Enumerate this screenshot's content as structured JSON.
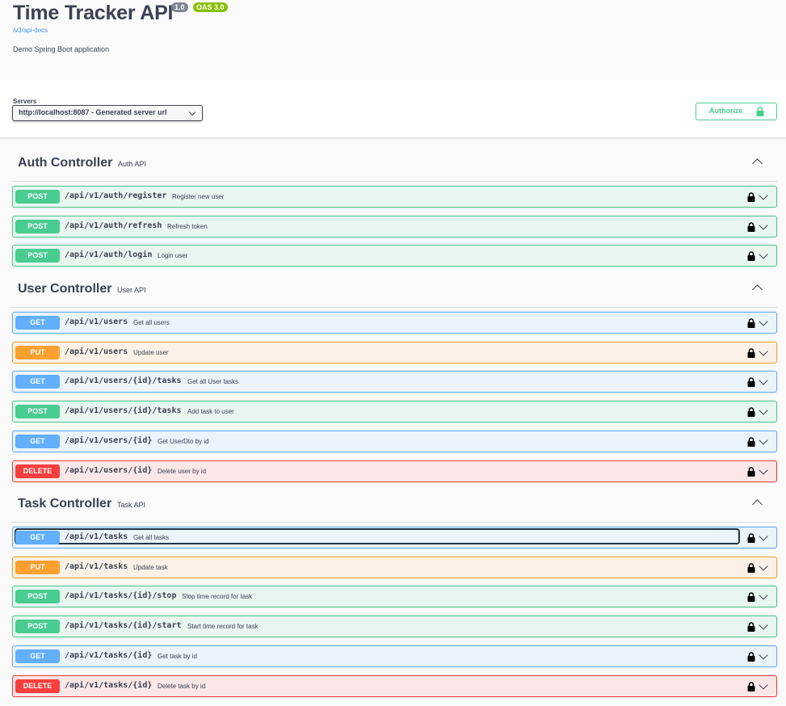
{
  "info": {
    "title": "Time Tracker API",
    "version": "1.0",
    "oas": "OAS 3.0",
    "docs_link": "/v3/api-docs",
    "description": "Demo Spring Boot application"
  },
  "scheme": {
    "servers_label": "Servers",
    "server_value": "http://localhost:8087 - Generated server url",
    "authorize_label": "Authorize"
  },
  "colors": {
    "post": "#49cc90",
    "get": "#61affe",
    "put": "#fca130",
    "delete": "#f93e3e"
  },
  "controllers": [
    {
      "name": "Auth Controller",
      "description": "Auth API",
      "operations": [
        {
          "method": "POST",
          "path": "/api/v1/auth/register",
          "summary": "Register new user"
        },
        {
          "method": "POST",
          "path": "/api/v1/auth/refresh",
          "summary": "Refresh token"
        },
        {
          "method": "POST",
          "path": "/api/v1/auth/login",
          "summary": "Login user"
        }
      ]
    },
    {
      "name": "User Controller",
      "description": "User API",
      "operations": [
        {
          "method": "GET",
          "path": "/api/v1/users",
          "summary": "Get all users"
        },
        {
          "method": "PUT",
          "path": "/api/v1/users",
          "summary": "Update user"
        },
        {
          "method": "GET",
          "path": "/api/v1/users/{id}/tasks",
          "summary": "Get all User tasks"
        },
        {
          "method": "POST",
          "path": "/api/v1/users/{id}/tasks",
          "summary": "Add task to user"
        },
        {
          "method": "GET",
          "path": "/api/v1/users/{id}",
          "summary": "Get UserDto by id"
        },
        {
          "method": "DELETE",
          "path": "/api/v1/users/{id}",
          "summary": "Delete user by id"
        }
      ]
    },
    {
      "name": "Task Controller",
      "description": "Task API",
      "operations": [
        {
          "method": "GET",
          "path": "/api/v1/tasks",
          "summary": "Get all tasks"
        },
        {
          "method": "PUT",
          "path": "/api/v1/tasks",
          "summary": "Update task"
        },
        {
          "method": "POST",
          "path": "/api/v1/tasks/{id}/stop",
          "summary": "Stop time record for task"
        },
        {
          "method": "POST",
          "path": "/api/v1/tasks/{id}/start",
          "summary": "Start time record for task"
        },
        {
          "method": "GET",
          "path": "/api/v1/tasks/{id}",
          "summary": "Get task by id"
        },
        {
          "method": "DELETE",
          "path": "/api/v1/tasks/{id}",
          "summary": "Delete task by id"
        }
      ]
    }
  ]
}
